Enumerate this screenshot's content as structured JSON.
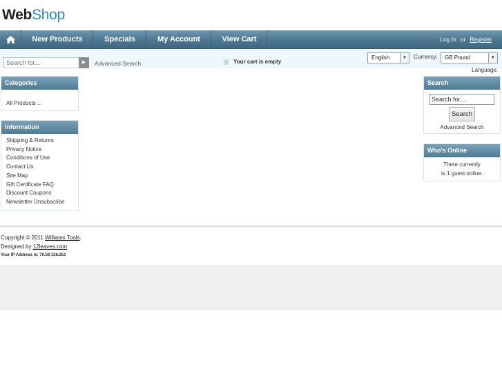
{
  "logo": {
    "part1": "Web",
    "part2": "Shop"
  },
  "nav": {
    "home_icon": "home-icon",
    "items": [
      "New Products",
      "Specials",
      "My Account",
      "View Cart"
    ],
    "login": "Log In",
    "or": "or",
    "register": "Register"
  },
  "topbar": {
    "search_placeholder": "Search for...",
    "advanced_search": "Advanced Search",
    "cart_icon": "cart-icon",
    "cart_status": "Your cart is empty",
    "language_value": "English",
    "currency_label": "Currency:",
    "currency_value": "GB Pound",
    "language_label": "Language:"
  },
  "categories": {
    "title": "Categories",
    "items": [
      "All Products ..."
    ]
  },
  "information": {
    "title": "Information",
    "items": [
      "Shipping & Returns",
      "Privacy Notice",
      "Conditions of Use",
      "Contact Us",
      "Site Map",
      "Gift Certificate FAQ",
      "Discount Coupons",
      "Newsletter Unsubscribe"
    ]
  },
  "search_box": {
    "title": "Search",
    "input_value": "Search for...",
    "button": "Search",
    "advanced": "Advanced Search"
  },
  "whos_online": {
    "title": "Who's Online",
    "line1": "There currently",
    "line2": "is 1 guest online."
  },
  "footer": {
    "copyright_prefix": "Copyright © 2011",
    "company": "Williams Tools",
    "copyright_suffix": ".",
    "designed_prefix": "Designed by",
    "designer": "12leaves.com",
    "ip": "Your IP Address is: 70.59.126.251"
  }
}
